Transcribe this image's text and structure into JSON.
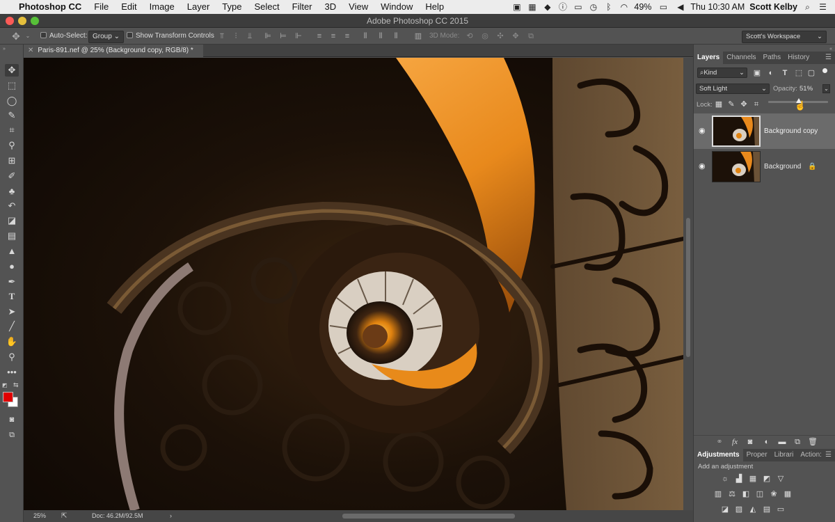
{
  "menubar": {
    "apple": "",
    "app": "Photoshop CC",
    "items": [
      "File",
      "Edit",
      "Image",
      "Layer",
      "Type",
      "Select",
      "Filter",
      "3D",
      "View",
      "Window",
      "Help"
    ],
    "battery": "49%",
    "clock": "Thu 10:30 AM",
    "user": "Scott Kelby"
  },
  "window": {
    "title": "Adobe Photoshop CC 2015"
  },
  "options": {
    "auto_select_label": "Auto-Select:",
    "group_value": "Group",
    "show_transform_label": "Show Transform Controls",
    "mode_3d": "3D Mode:",
    "workspace": "Scott's Workspace"
  },
  "document": {
    "tab_label": "Paris-891.nef @ 25% (Background copy, RGB/8) *",
    "zoom": "25%",
    "doc_size": "Doc: 46.2M/92.5M"
  },
  "layers_panel": {
    "tabs": [
      "Layers",
      "Channels",
      "Paths",
      "History"
    ],
    "filter_value": "Kind",
    "blend_mode": "Soft Light",
    "opacity_label": "Opacity:",
    "opacity_value": "51%",
    "opacity_fraction": 0.51,
    "lock_label": "Lock:",
    "layers": [
      {
        "name": "Background copy",
        "selected": true
      },
      {
        "name": "Background",
        "selected": false,
        "locked": true
      }
    ]
  },
  "adjustments_panel": {
    "tabs": [
      "Adjustments",
      "Proper",
      "Librari",
      "Action:"
    ],
    "hint": "Add an adjustment"
  },
  "colors": {
    "foreground": "#e10000",
    "background": "#ffffff",
    "accent": "#f0a020"
  }
}
